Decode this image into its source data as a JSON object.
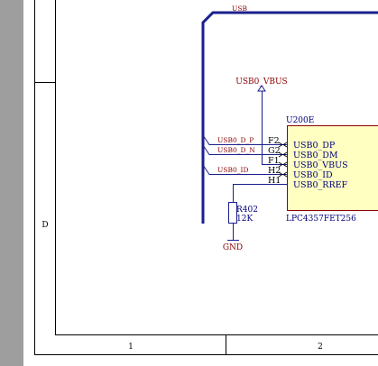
{
  "sheet": {
    "zone_row": "D",
    "zone_columns": [
      "1",
      "2"
    ]
  },
  "bus": {
    "label": "USB"
  },
  "power": {
    "vbus_label": "USB0_VBUS",
    "gnd_label": "GND"
  },
  "nets": [
    {
      "label": "USB0_D_P"
    },
    {
      "label": "USB0_D_N"
    },
    {
      "label": "USB0_ID"
    }
  ],
  "ic": {
    "designator": "U200E",
    "part": "LPC4357FET256",
    "pins": [
      {
        "number": "F2",
        "name": "USB0_DP"
      },
      {
        "number": "G2",
        "name": "USB0_DM"
      },
      {
        "number": "F1",
        "name": "USB0_VBUS"
      },
      {
        "number": "H2",
        "name": "USB0_ID"
      },
      {
        "number": "H1",
        "name": "USB0_RREF"
      }
    ]
  },
  "resistor": {
    "designator": "R402",
    "value": "12K"
  },
  "colors": {
    "frame_gray": "#9e9e9e",
    "bus": "#1a1f8c",
    "wire": "#1a1f8c",
    "ic_fill": "#ffffc2",
    "ic_border": "#8b0000",
    "net_text": "#8b0000"
  }
}
